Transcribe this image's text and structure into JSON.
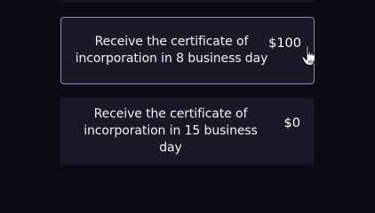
{
  "options": [
    {
      "description": "Receive the certificate of incorporation in 8 business day",
      "price": "$100",
      "selected": true
    },
    {
      "description": "Receive the certificate of incorporation in 15 business day",
      "price": "$0",
      "selected": false
    }
  ],
  "colors": {
    "background": "#0b0a16",
    "card": "#1a1826",
    "selected_border": "#8a8bb0",
    "text": "#f2f2f5"
  },
  "cursor_icon": "hand-pointer-icon"
}
